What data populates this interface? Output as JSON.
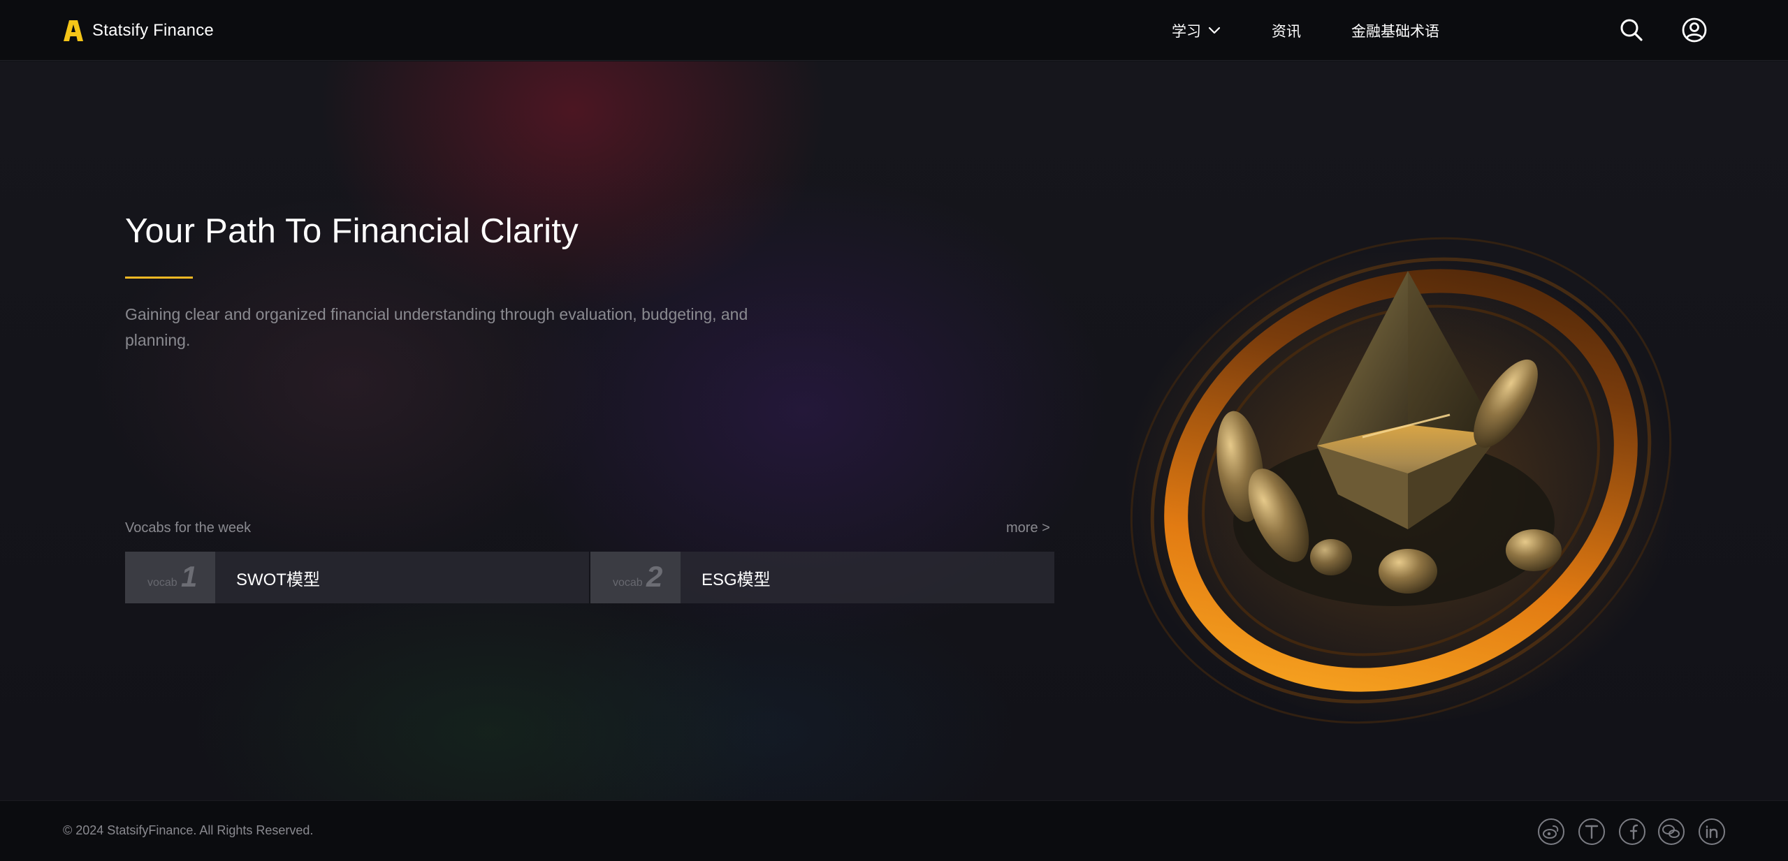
{
  "brand": {
    "name": "Statsify Finance",
    "logo_icon": "yellow-a-logo",
    "accent": "#f5c518"
  },
  "nav": {
    "learn_label": "学习",
    "news_label": "资讯",
    "glossary_label": "金融基础术语"
  },
  "header_icons": [
    "search-icon",
    "user-account-icon"
  ],
  "hero": {
    "title": "Your Path To Financial Clarity",
    "subtitle": "Gaining clear and organized financial understanding through evaluation, budgeting, and planning.",
    "accent_rule_color": "#f2b824",
    "illustration": "golden-hand-holding-pyramid-with-orange-ring"
  },
  "vocab": {
    "heading": "Vocabs for the week",
    "more_label": "more >",
    "items": [
      {
        "prefix": "vocab",
        "number": "1",
        "term": "SWOT模型"
      },
      {
        "prefix": "vocab",
        "number": "2",
        "term": "ESG模型"
      }
    ]
  },
  "footer": {
    "copyright": "© 2024 StatsifyFinance. All Rights Reserved.",
    "social_icons": [
      "weibo-icon",
      "toutiao-icon",
      "facebook-icon",
      "wechat-icon",
      "linkedin-icon"
    ]
  }
}
